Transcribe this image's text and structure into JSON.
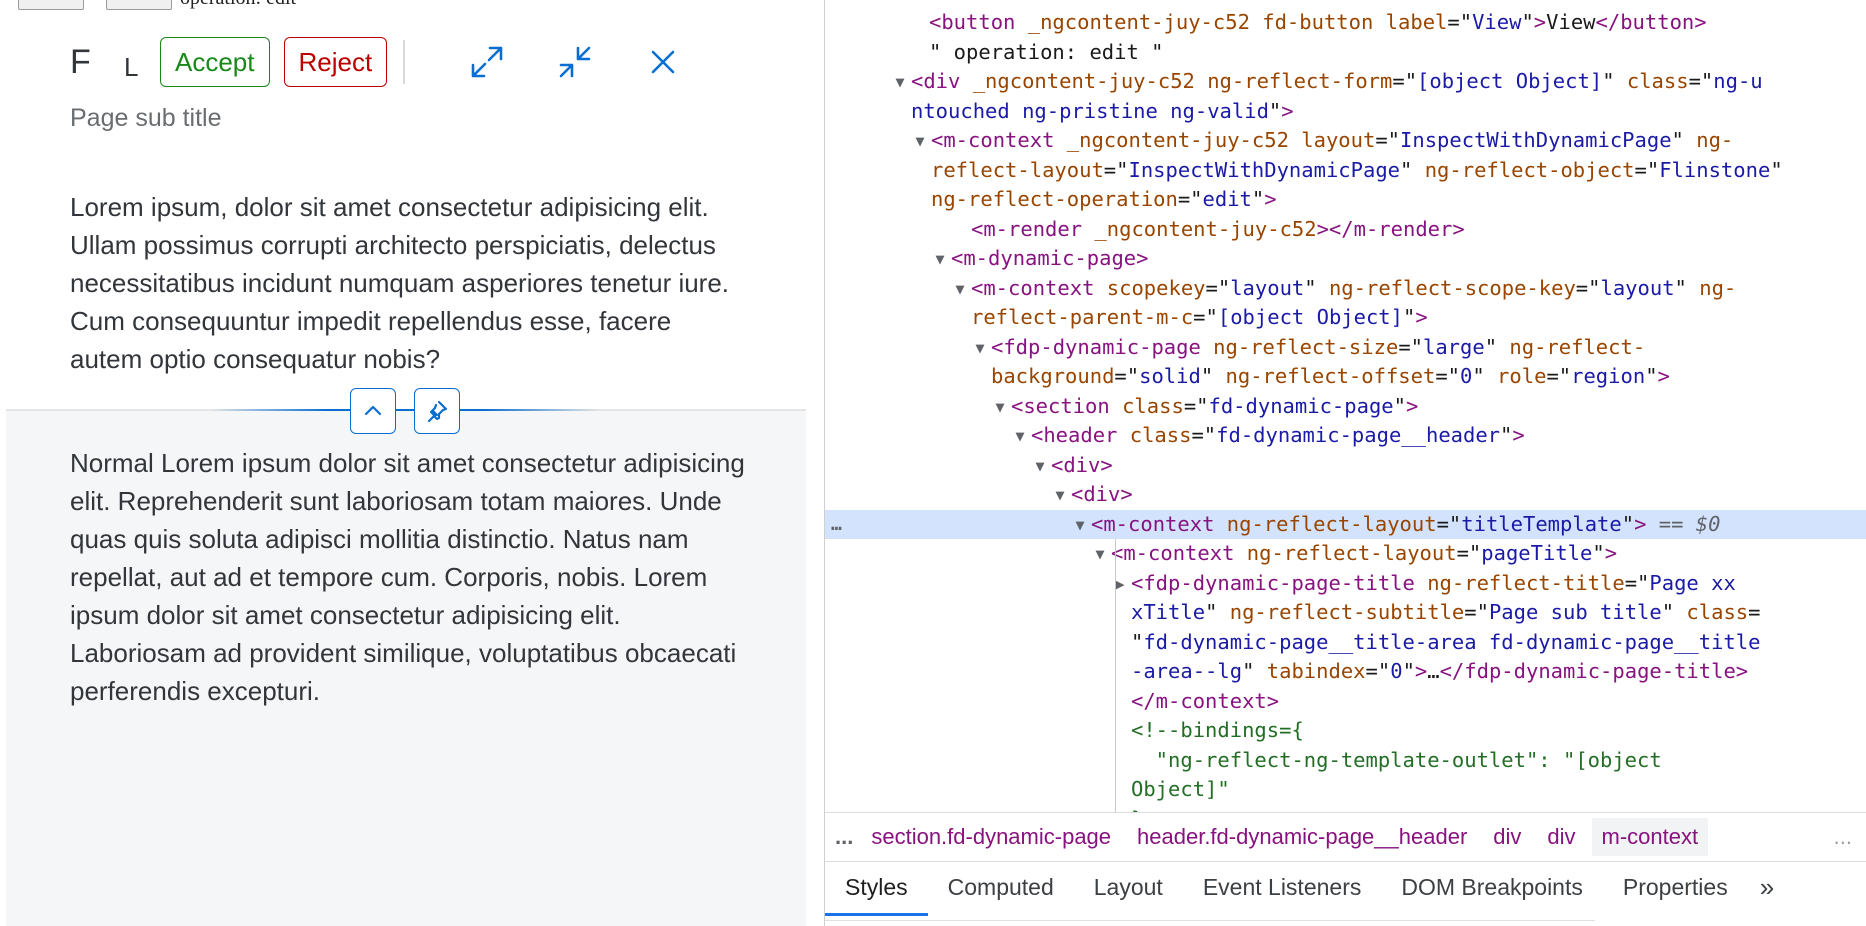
{
  "app": {
    "top_remnant_text": "operation: edit",
    "page_title": "F",
    "page_title_short": "L",
    "accept_label": "Accept",
    "reject_label": "Reject",
    "subtitle": "Page sub title",
    "header_paragraph": "Lorem ipsum, dolor sit amet consectetur adipisicing elit. Ullam possimus corrupti architecto perspiciatis, delectus necessitatibus incidunt numquam asperiores tenetur iure. Cum consequuntur impedit repellendus esse, facere autem optio consequatur nobis?",
    "content_paragraph": "Normal Lorem ipsum dolor sit amet consectetur adipisicing elit. Reprehenderit sunt laboriosam totam maiores. Unde quas quis soluta adipisci mollitia distinctio. Natus nam repellat, aut ad et tempore cum. Corporis, nobis. Lorem ipsum dolor sit amet consectetur adipisicing elit. Laboriosam ad provident similique, voluptatibus obcaecati perferendis excepturi.",
    "icons": {
      "expand": "expand-icon",
      "collapse": "exit-full-screen-icon",
      "close": "close-icon",
      "header_collapse": "chevron-up-icon",
      "header_pin": "pin-icon"
    },
    "colors": {
      "accent": "#0a6ed1",
      "accept": "#188918",
      "reject": "#bb0000",
      "text": "#32363a",
      "subtitle": "#6a6d70"
    }
  },
  "devtools": {
    "dom_lines": [
      [
        [
          "tg",
          "<button"
        ],
        [
          "an",
          " _ngcontent-juy-c52"
        ],
        [
          "an",
          " fd-button"
        ],
        [
          "an",
          " label"
        ],
        [
          "pl",
          "=\""
        ],
        [
          "av",
          "View"
        ],
        [
          "pl",
          "\""
        ],
        [
          "tg",
          ">"
        ],
        [
          "tx",
          "View"
        ],
        [
          "tg",
          "</button>"
        ]
      ],
      [
        [
          "tx",
          "\" operation: edit \""
        ]
      ],
      [
        [
          "tg",
          "<div"
        ],
        [
          "an",
          " _ngcontent-juy-c52"
        ],
        [
          "an",
          " ng-reflect-form"
        ],
        [
          "pl",
          "=\""
        ],
        [
          "av",
          "[object Object]"
        ],
        [
          "pl",
          "\""
        ],
        [
          "an",
          " class"
        ],
        [
          "pl",
          "=\""
        ],
        [
          "av",
          "ng-u"
        ]
      ],
      [
        [
          "av",
          "ntouched ng-pristine ng-valid"
        ],
        [
          "pl",
          "\""
        ],
        [
          "tg",
          ">"
        ]
      ],
      [
        [
          "tg",
          "<m-context"
        ],
        [
          "an",
          " _ngcontent-juy-c52"
        ],
        [
          "an",
          " layout"
        ],
        [
          "pl",
          "=\""
        ],
        [
          "av",
          "InspectWithDynamicPage"
        ],
        [
          "pl",
          "\""
        ],
        [
          "an",
          " ng-"
        ]
      ],
      [
        [
          "an",
          "reflect-layout"
        ],
        [
          "pl",
          "=\""
        ],
        [
          "av",
          "InspectWithDynamicPage"
        ],
        [
          "pl",
          "\""
        ],
        [
          "an",
          " ng-reflect-object"
        ],
        [
          "pl",
          "=\""
        ],
        [
          "av",
          "Flinstone"
        ],
        [
          "pl",
          "\""
        ]
      ],
      [
        [
          "an",
          "ng-reflect-operation"
        ],
        [
          "pl",
          "=\""
        ],
        [
          "av",
          "edit"
        ],
        [
          "pl",
          "\""
        ],
        [
          "tg",
          ">"
        ]
      ],
      [
        [
          "tg",
          "<m-render"
        ],
        [
          "an",
          " _ngcontent-juy-c52"
        ],
        [
          "tg",
          "></m-render>"
        ]
      ],
      [
        [
          "tg",
          "<m-dynamic-page>"
        ]
      ],
      [
        [
          "tg",
          "<m-context"
        ],
        [
          "an",
          " scopekey"
        ],
        [
          "pl",
          "=\""
        ],
        [
          "av",
          "layout"
        ],
        [
          "pl",
          "\""
        ],
        [
          "an",
          " ng-reflect-scope-key"
        ],
        [
          "pl",
          "=\""
        ],
        [
          "av",
          "layout"
        ],
        [
          "pl",
          "\""
        ],
        [
          "an",
          " ng-"
        ]
      ],
      [
        [
          "an",
          "reflect-parent-m-c"
        ],
        [
          "pl",
          "=\""
        ],
        [
          "av",
          "[object Object]"
        ],
        [
          "pl",
          "\""
        ],
        [
          "tg",
          ">"
        ]
      ],
      [
        [
          "tg",
          "<fdp-dynamic-page"
        ],
        [
          "an",
          " ng-reflect-size"
        ],
        [
          "pl",
          "=\""
        ],
        [
          "av",
          "large"
        ],
        [
          "pl",
          "\""
        ],
        [
          "an",
          " ng-reflect-"
        ]
      ],
      [
        [
          "an",
          "background"
        ],
        [
          "pl",
          "=\""
        ],
        [
          "av",
          "solid"
        ],
        [
          "pl",
          "\""
        ],
        [
          "an",
          " ng-reflect-offset"
        ],
        [
          "pl",
          "=\""
        ],
        [
          "av",
          "0"
        ],
        [
          "pl",
          "\""
        ],
        [
          "an",
          " role"
        ],
        [
          "pl",
          "=\""
        ],
        [
          "av",
          "region"
        ],
        [
          "pl",
          "\""
        ],
        [
          "tg",
          ">"
        ]
      ],
      [
        [
          "tg",
          "<section"
        ],
        [
          "an",
          " class"
        ],
        [
          "pl",
          "=\""
        ],
        [
          "av",
          "fd-dynamic-page"
        ],
        [
          "pl",
          "\""
        ],
        [
          "tg",
          ">"
        ]
      ],
      [
        [
          "tg",
          "<header"
        ],
        [
          "an",
          " class"
        ],
        [
          "pl",
          "=\""
        ],
        [
          "av",
          "fd-dynamic-page__header"
        ],
        [
          "pl",
          "\""
        ],
        [
          "tg",
          ">"
        ]
      ],
      [
        [
          "tg",
          "<div>"
        ]
      ],
      [
        [
          "tg",
          "<div>"
        ]
      ],
      [
        [
          "tg",
          "<m-context"
        ],
        [
          "an",
          " ng-reflect-layout"
        ],
        [
          "pl",
          "=\""
        ],
        [
          "av",
          "titleTemplate"
        ],
        [
          "pl",
          "\""
        ],
        [
          "tg",
          ">"
        ]
      ],
      [
        [
          "tg",
          "<m-context"
        ],
        [
          "an",
          " ng-reflect-layout"
        ],
        [
          "pl",
          "=\""
        ],
        [
          "av",
          "pageTitle"
        ],
        [
          "pl",
          "\""
        ],
        [
          "tg",
          ">"
        ]
      ],
      [
        [
          "tg",
          "<fdp-dynamic-page-title"
        ],
        [
          "an",
          " ng-reflect-title"
        ],
        [
          "pl",
          "=\""
        ],
        [
          "av",
          "Page xx"
        ]
      ],
      [
        [
          "av",
          "xTitle"
        ],
        [
          "pl",
          "\""
        ],
        [
          "an",
          " ng-reflect-subtitle"
        ],
        [
          "pl",
          "=\""
        ],
        [
          "av",
          "Page sub title"
        ],
        [
          "pl",
          "\""
        ],
        [
          "an",
          " class"
        ],
        [
          "pl",
          "="
        ]
      ],
      [
        [
          "pl",
          "\""
        ],
        [
          "av",
          "fd-dynamic-page__title-area fd-dynamic-page__title"
        ]
      ],
      [
        [
          "av",
          "-area--lg"
        ],
        [
          "pl",
          "\""
        ],
        [
          "an",
          " tabindex"
        ],
        [
          "pl",
          "=\""
        ],
        [
          "av",
          "0"
        ],
        [
          "pl",
          "\""
        ],
        [
          "tg",
          ">"
        ],
        [
          "tx",
          "…"
        ],
        [
          "tg",
          "</fdp-dynamic-page-title>"
        ]
      ],
      [
        [
          "tg",
          "</m-context>"
        ]
      ],
      [
        [
          "cm",
          "<!--bindings={"
        ]
      ],
      [
        [
          "cm",
          "  \"ng-reflect-ng-template-outlet\": \"[object"
        ]
      ],
      [
        [
          "cm",
          "Object]\""
        ]
      ],
      [
        [
          "cm",
          "}-->"
        ]
      ]
    ],
    "selected_suffix": " == $0",
    "breadcrumb_ellipsis": "...",
    "breadcrumbs": [
      "section.fd-dynamic-page",
      "header.fd-dynamic-page__header",
      "div",
      "div",
      "m-context"
    ],
    "breadcrumb_more": "...",
    "panel_tabs": [
      "Styles",
      "Computed",
      "Layout",
      "Event Listeners",
      "DOM Breakpoints",
      "Properties"
    ],
    "tab_overflow": "»"
  }
}
